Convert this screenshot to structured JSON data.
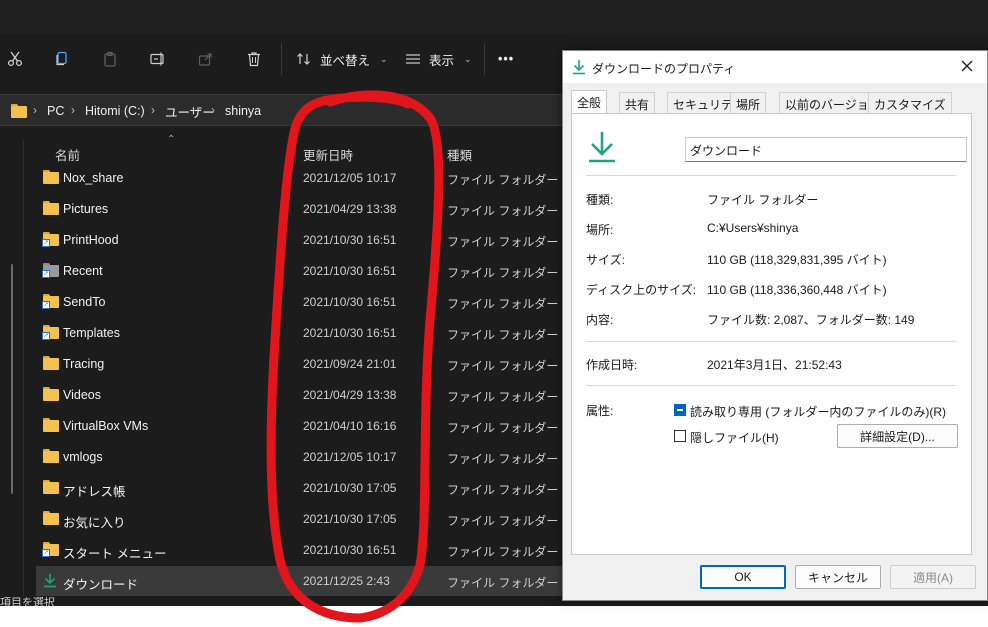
{
  "toolbar": {
    "sort_label": "並べ替え",
    "view_label": "表示",
    "more_label": "•••"
  },
  "address": {
    "crumbs": [
      "PC",
      "Hitomi (C:)",
      "ユーザー",
      "shinya"
    ]
  },
  "columns": {
    "name": "名前",
    "date": "更新日時",
    "type": "種類"
  },
  "files": [
    {
      "name": "Nox_share",
      "date": "2021/12/05 10:17",
      "type": "ファイル フォルダー",
      "icon": "folder-icon"
    },
    {
      "name": "Pictures",
      "date": "2021/04/29 13:38",
      "type": "ファイル フォルダー",
      "icon": "folder-icon"
    },
    {
      "name": "PrintHood",
      "date": "2021/10/30 16:51",
      "type": "ファイル フォルダー",
      "icon": "shortcut-folder-icon"
    },
    {
      "name": "Recent",
      "date": "2021/10/30 16:51",
      "type": "ファイル フォルダー",
      "icon": "recent-folder-icon"
    },
    {
      "name": "SendTo",
      "date": "2021/10/30 16:51",
      "type": "ファイル フォルダー",
      "icon": "shortcut-folder-icon"
    },
    {
      "name": "Templates",
      "date": "2021/10/30 16:51",
      "type": "ファイル フォルダー",
      "icon": "shortcut-folder-icon"
    },
    {
      "name": "Tracing",
      "date": "2021/09/24 21:01",
      "type": "ファイル フォルダー",
      "icon": "folder-icon"
    },
    {
      "name": "Videos",
      "date": "2021/04/29 13:38",
      "type": "ファイル フォルダー",
      "icon": "folder-icon"
    },
    {
      "name": "VirtualBox VMs",
      "date": "2021/04/10 16:16",
      "type": "ファイル フォルダー",
      "icon": "folder-icon"
    },
    {
      "name": "vmlogs",
      "date": "2021/12/05 10:17",
      "type": "ファイル フォルダー",
      "icon": "folder-icon"
    },
    {
      "name": "アドレス帳",
      "date": "2021/10/30 17:05",
      "type": "ファイル フォルダー",
      "icon": "folder-icon"
    },
    {
      "name": "お気に入り",
      "date": "2021/10/30 17:05",
      "type": "ファイル フォルダー",
      "icon": "folder-icon"
    },
    {
      "name": "スタート メニュー",
      "date": "2021/10/30 16:51",
      "type": "ファイル フォルダー",
      "icon": "shortcut-folder-icon"
    },
    {
      "name": "ダウンロード",
      "date": "2021/12/25 2:43",
      "type": "ファイル フォルダー",
      "icon": "download-icon"
    }
  ],
  "statusbar": {
    "text": "項目を選択"
  },
  "dialog": {
    "title": "ダウンロードのプロパティ",
    "tabs": [
      "全般",
      "共有",
      "セキュリティ",
      "場所",
      "以前のバージョン",
      "カスタマイズ"
    ],
    "active_tab": "全般",
    "name": "ダウンロード",
    "rows": [
      {
        "label": "種類:",
        "value": "ファイル フォルダー"
      },
      {
        "label": "場所:",
        "value": "C:¥Users¥shinya"
      },
      {
        "label": "サイズ:",
        "value": "110 GB (118,329,831,395 バイト)"
      },
      {
        "label": "ディスク上のサイズ:",
        "value": "110 GB (118,336,360,448 バイト)"
      },
      {
        "label": "内容:",
        "value": "ファイル数: 2,087、フォルダー数: 149"
      }
    ],
    "created_label": "作成日時:",
    "created_value": "2021年3月1日、21:52:43",
    "attributes_label": "属性:",
    "readonly_label": "読み取り専用 (フォルダー内のファイルのみ)(R)",
    "hidden_label": "隠しファイル(H)",
    "advanced_button": "詳細設定(D)...",
    "ok_button": "OK",
    "cancel_button": "キャンセル",
    "apply_button": "適用(A)"
  },
  "colors": {
    "explorer_bg": "#1c1c1c",
    "accent": "#0067c0",
    "download_green": "#1fa37c",
    "annotation_red": "#e0161c",
    "folder_yellow": "#f2c14e"
  }
}
